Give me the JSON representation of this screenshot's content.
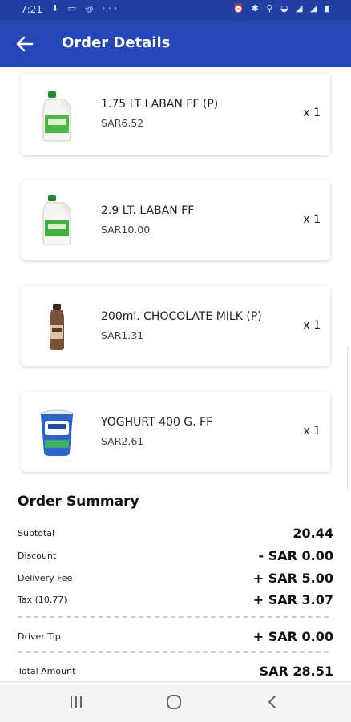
{
  "status_bar": {
    "time": "7:21",
    "left_icons": "⬇ ▭ ◎ ···",
    "right_icons": "⏰ ✱ ⚲ ◒ ◢ ◢ ▮"
  },
  "header": {
    "title": "Order Details",
    "back_icon": "arrow-left-icon"
  },
  "items": [
    {
      "name": "1.75 LT LABAN FF (P)",
      "price": "SAR6.52",
      "qty": "x 1",
      "icon": "milk-jug-icon"
    },
    {
      "name": "2.9 LT. LABAN FF",
      "price": "SAR10.00",
      "qty": "x 1",
      "icon": "milk-jug-icon"
    },
    {
      "name": "200ml. CHOCOLATE MILK (P)",
      "price": "SAR1.31",
      "qty": "x 1",
      "icon": "chocolate-milk-bottle-icon"
    },
    {
      "name": "YOGHURT 400 G. FF",
      "price": "SAR2.61",
      "qty": "x 1",
      "icon": "yoghurt-cup-icon"
    }
  ],
  "summary": {
    "title": "Order Summary",
    "subtotal": {
      "label": "Subtotal",
      "value": "20.44"
    },
    "discount": {
      "label": "Discount",
      "value": "- SAR 0.00"
    },
    "delivery_fee": {
      "label": "Delivery Fee",
      "value": "+ SAR 5.00"
    },
    "tax": {
      "label": "Tax (10.77)",
      "value": "+ SAR 3.07"
    },
    "driver_tip": {
      "label": "Driver Tip",
      "value": "+ SAR 0.00"
    },
    "total": {
      "label": "Total Amount",
      "value": "SAR 28.51"
    }
  },
  "colors": {
    "header": "#2547b7",
    "status_bar": "#1f3fa3",
    "background": "#ffffff",
    "nav_bar": "#f4f4f4"
  }
}
